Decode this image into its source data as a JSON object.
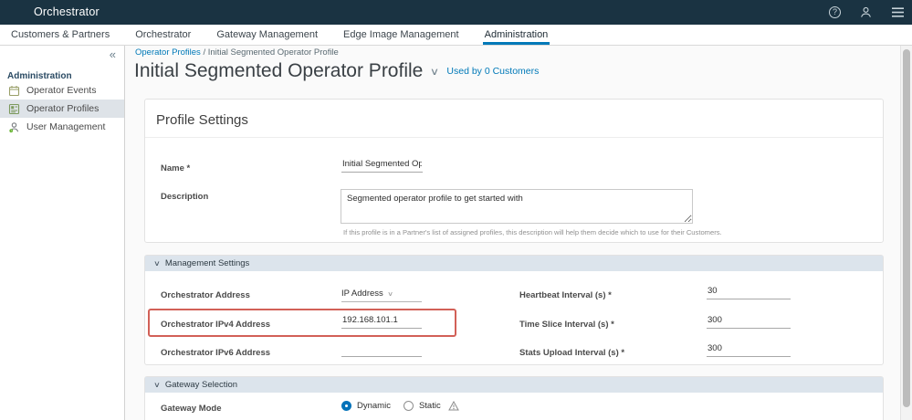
{
  "colors": {
    "header_bg": "#1a3342",
    "accent_blue": "#0079b8",
    "highlight_box_red": "#ce5349",
    "section_bar_bg": "#dce4ec",
    "selected_sidebar_bg": "#dee3e8"
  },
  "header": {
    "app_title": "Orchestrator",
    "help_glyph": "?"
  },
  "tabs": [
    {
      "label": "Customers & Partners",
      "active": false
    },
    {
      "label": "Orchestrator",
      "active": false
    },
    {
      "label": "Gateway Management",
      "active": false
    },
    {
      "label": "Edge Image Management",
      "active": false
    },
    {
      "label": "Administration",
      "active": true
    }
  ],
  "sidebar": {
    "collapse_glyph": "«",
    "section_title": "Administration",
    "items": [
      {
        "label": "Operator Events",
        "icon": "calendar-icon",
        "selected": false
      },
      {
        "label": "Operator Profiles",
        "icon": "profile-badge-icon",
        "selected": true
      },
      {
        "label": "User Management",
        "icon": "user-icon",
        "selected": false
      }
    ]
  },
  "breadcrumb": {
    "link": "Operator Profiles",
    "separator": "/",
    "current": "Initial Segmented Operator Profile"
  },
  "page_header": {
    "title": "Initial Segmented Operator Profile",
    "caret_glyph": "∨",
    "used_by": "Used by 0 Customers"
  },
  "profile_settings": {
    "title": "Profile Settings",
    "name_label": "Name *",
    "name_value": "Initial Segmented Opera",
    "description_label": "Description",
    "description_value": "Segmented operator profile to get started with",
    "description_help": "If this profile is in a Partner's list of assigned profiles, this description will help them decide which to use for their Customers."
  },
  "management_settings": {
    "title": "Management Settings",
    "caret_glyph": "∨",
    "left_fields": [
      {
        "label": "Orchestrator Address",
        "value": "IP Address",
        "control": "select"
      },
      {
        "label": "Orchestrator IPv4 Address",
        "value": "192.168.101.1",
        "control": "input",
        "highlighted": true
      },
      {
        "label": "Orchestrator IPv6 Address",
        "value": "",
        "control": "input",
        "highlighted": false
      }
    ],
    "right_fields": [
      {
        "label": "Heartbeat Interval (s) *",
        "value": "30"
      },
      {
        "label": "Time Slice Interval (s) *",
        "value": "300"
      },
      {
        "label": "Stats Upload Interval (s) *",
        "value": "300"
      }
    ]
  },
  "gateway_selection": {
    "title": "Gateway Selection",
    "caret_glyph": "∨",
    "mode_label": "Gateway Mode",
    "options": [
      {
        "label": "Dynamic",
        "selected": true,
        "has_warning": false
      },
      {
        "label": "Static",
        "selected": false,
        "has_warning": true
      }
    ]
  }
}
